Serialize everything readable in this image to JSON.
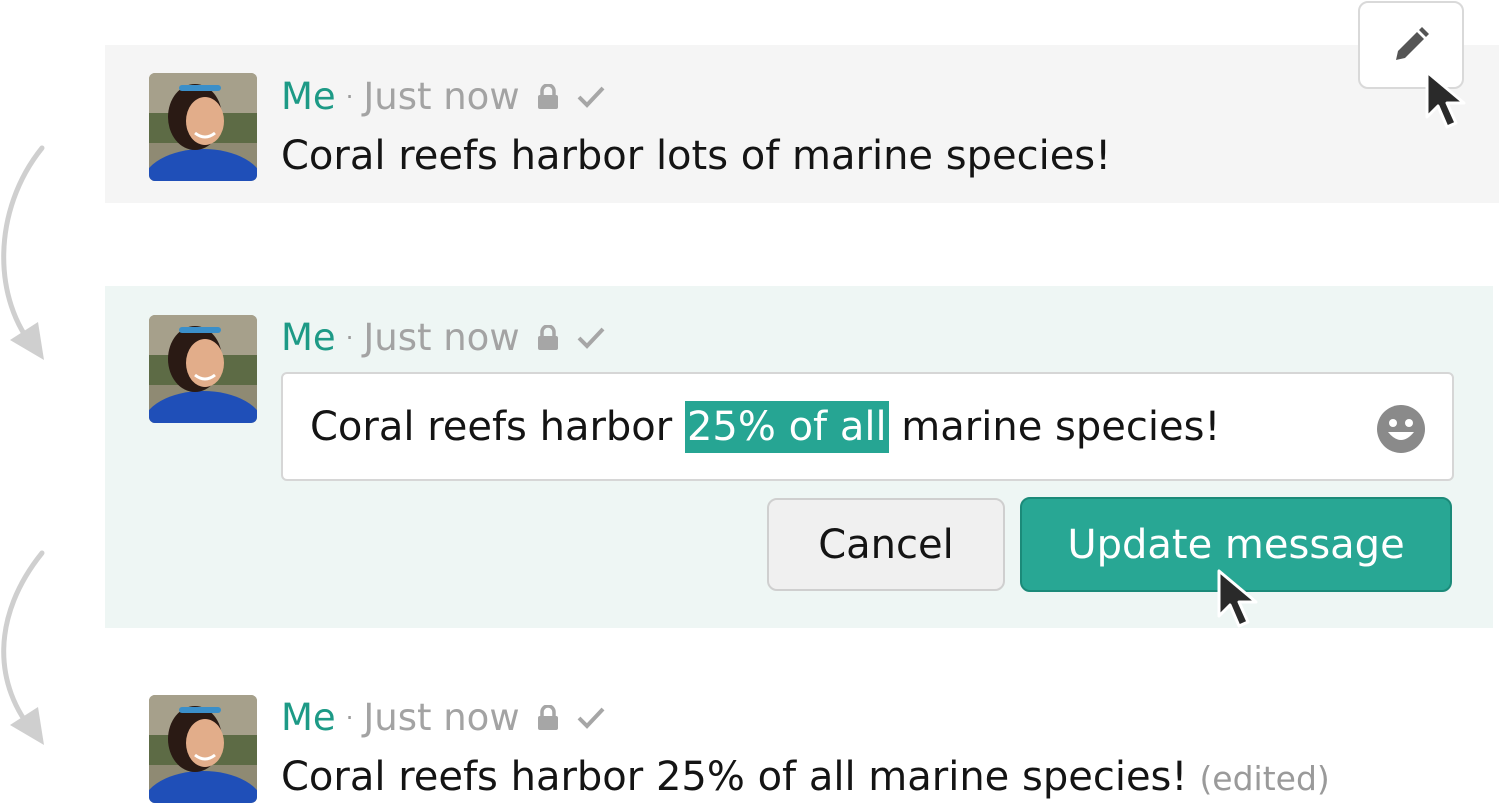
{
  "message_before": {
    "sender": "Me",
    "separator": "·",
    "time": "Just now",
    "text": "Coral reefs harbor lots of marine species!"
  },
  "message_editing": {
    "sender": "Me",
    "separator": "·",
    "time": "Just now",
    "input_before": "Coral reefs harbor ",
    "input_selected": "25% of all",
    "input_after": " marine species!",
    "cancel_label": "Cancel",
    "update_label": "Update message"
  },
  "message_after": {
    "sender": "Me",
    "separator": "·",
    "time": "Just now",
    "text": "Coral reefs harbor 25% of all marine species!",
    "edited_label": "(edited)"
  },
  "colors": {
    "accent": "#28a794",
    "sender": "#1d9a86",
    "editing_bg": "#eef6f4"
  },
  "icons": [
    "pencil-icon",
    "lock-icon",
    "check-icon",
    "smiley-icon",
    "cursor-icon",
    "arrow-icon"
  ]
}
